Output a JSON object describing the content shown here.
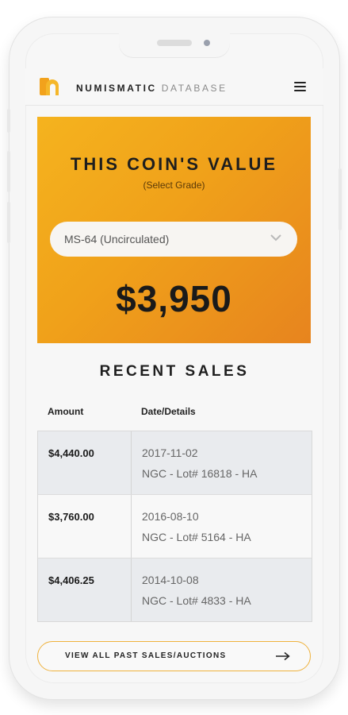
{
  "header": {
    "brand_bold": "NUMISMATIC",
    "brand_light": "DATABASE",
    "logo_icon": "coin-logo-icon",
    "menu_icon": "hamburger-menu-icon"
  },
  "value_card": {
    "title": "THIS COIN'S VALUE",
    "subtitle": "(Select Grade)",
    "selected_grade": "MS-64 (Uncirculated)",
    "price": "$3,950"
  },
  "recent_sales": {
    "title": "RECENT SALES",
    "columns": [
      "Amount",
      "Date/Details"
    ],
    "rows": [
      {
        "amount": "$4,440.00",
        "date": "2017-11-02",
        "details": "NGC - Lot# 16818 - HA"
      },
      {
        "amount": "$3,760.00",
        "date": "2016-08-10",
        "details": "NGC - Lot# 5164 - HA"
      },
      {
        "amount": "$4,406.25",
        "date": "2014-10-08",
        "details": "NGC - Lot# 4833 - HA"
      }
    ]
  },
  "view_all": {
    "label": "VIEW ALL PAST SALES/AUCTIONS",
    "icon": "arrow-right-icon"
  },
  "colors": {
    "accent": "#f0a11a",
    "accent_dark": "#e7841e",
    "button_border": "#efb23d",
    "text_dark": "#1e1e1e"
  }
}
